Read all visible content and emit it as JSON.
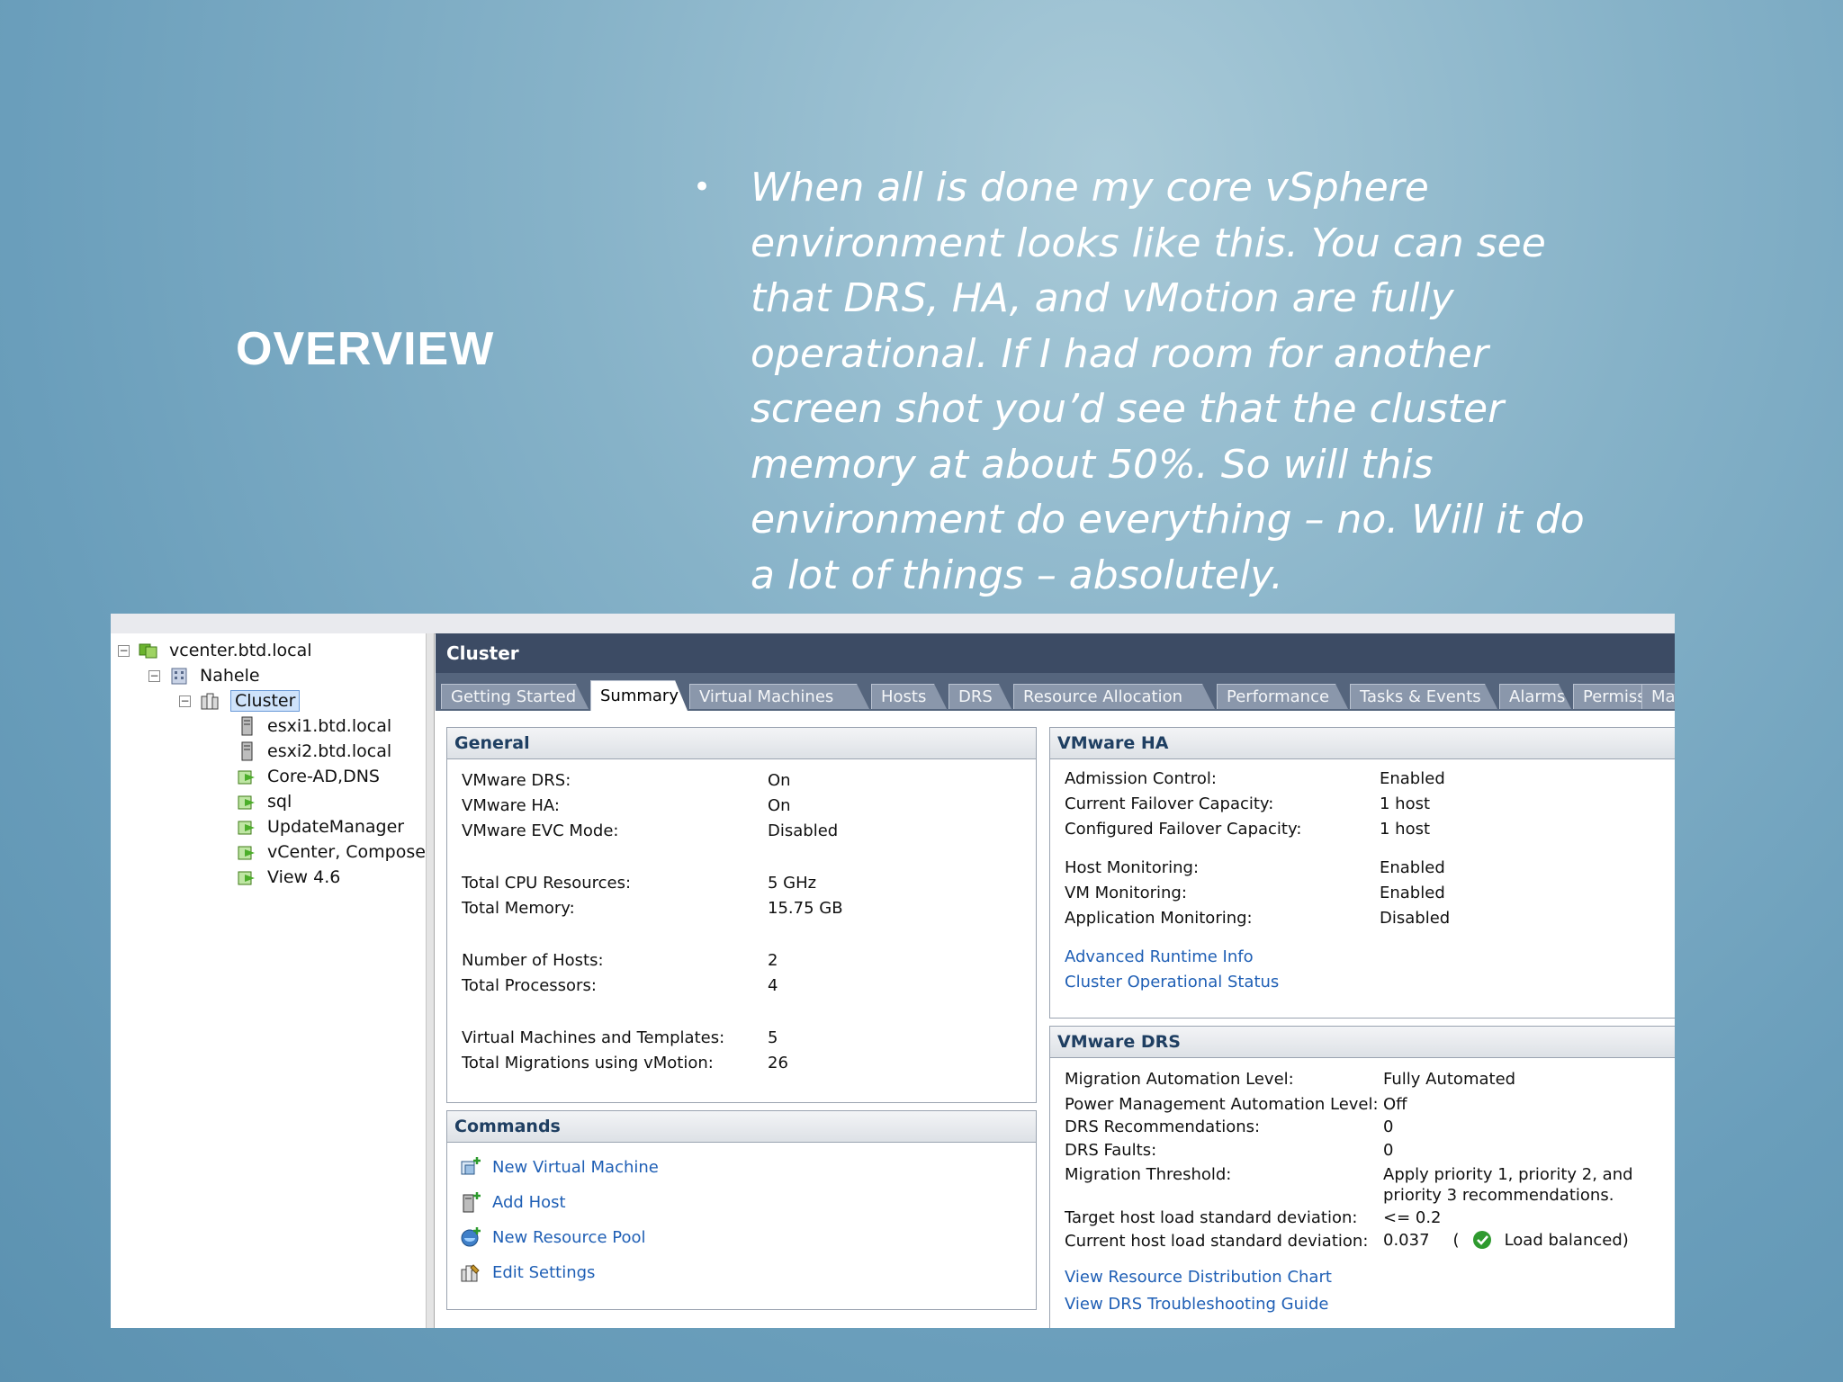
{
  "slide": {
    "title": "OVERVIEW",
    "bullet_symbol": "•",
    "bullet": "When all is done my core vSphere environment looks like this. You can see that DRS, HA, and vMotion are fully operational. If I had room for another screen shot you’d see that the cluster memory at about 50%. So will this environment do everything – no. Will it do a lot of things – absolutely."
  },
  "tree": {
    "items": [
      {
        "label": "vcenter.btd.local",
        "icon": "vcenter-icon"
      },
      {
        "label": "Nahele",
        "icon": "datacenter-icon"
      },
      {
        "label": "Cluster",
        "icon": "cluster-icon"
      },
      {
        "label": "esxi1.btd.local",
        "icon": "host-icon"
      },
      {
        "label": "esxi2.btd.local",
        "icon": "host-icon"
      },
      {
        "label": "Core-AD,DNS",
        "icon": "vm-icon"
      },
      {
        "label": "sql",
        "icon": "vm-icon"
      },
      {
        "label": "UpdateManager",
        "icon": "vm-icon"
      },
      {
        "label": "vCenter, Composer",
        "icon": "vm-icon"
      },
      {
        "label": "View 4.6",
        "icon": "vm-icon"
      }
    ]
  },
  "main": {
    "title": "Cluster",
    "tabs": [
      "Getting Started",
      "Summary",
      "Virtual Machines",
      "Hosts",
      "DRS",
      "Resource Allocation",
      "Performance",
      "Tasks & Events",
      "Alarms",
      "Permissions",
      "Maps"
    ],
    "active_tab": "Summary"
  },
  "general": {
    "title": "General",
    "rows": [
      {
        "label": "VMware DRS:",
        "value": "On"
      },
      {
        "label": "VMware HA:",
        "value": "On"
      },
      {
        "label": "VMware EVC Mode:",
        "value": "Disabled"
      },
      {
        "label": "Total CPU Resources:",
        "value": "5 GHz"
      },
      {
        "label": "Total Memory:",
        "value": "15.75 GB"
      },
      {
        "label": "Number of Hosts:",
        "value": "2"
      },
      {
        "label": "Total Processors:",
        "value": "4"
      },
      {
        "label": "Virtual Machines and Templates:",
        "value": "5"
      },
      {
        "label": "Total Migrations using vMotion:",
        "value": "26"
      }
    ]
  },
  "commands": {
    "title": "Commands",
    "items": [
      {
        "label": "New Virtual Machine",
        "icon": "new-vm-icon"
      },
      {
        "label": "Add Host",
        "icon": "add-host-icon"
      },
      {
        "label": "New Resource Pool",
        "icon": "resource-pool-icon"
      },
      {
        "label": "Edit Settings",
        "icon": "edit-settings-icon"
      }
    ]
  },
  "ha": {
    "title": "VMware HA",
    "rows": [
      {
        "label": "Admission Control:",
        "value": "Enabled"
      },
      {
        "label": "Current Failover Capacity:",
        "value": "1 host"
      },
      {
        "label": "Configured Failover Capacity:",
        "value": "1 host"
      },
      {
        "label": "Host Monitoring:",
        "value": "Enabled"
      },
      {
        "label": "VM Monitoring:",
        "value": "Enabled"
      },
      {
        "label": "Application Monitoring:",
        "value": "Disabled"
      }
    ],
    "links": [
      "Advanced Runtime Info",
      "Cluster Operational Status"
    ]
  },
  "drs": {
    "title": "VMware DRS",
    "rows": [
      {
        "label": "Migration Automation Level:",
        "value": "Fully Automated"
      },
      {
        "label": "Power Management Automation Level:",
        "value": "Off"
      },
      {
        "label": "DRS Recommendations:",
        "value": "0"
      },
      {
        "label": "DRS Faults:",
        "value": "0"
      },
      {
        "label": "Migration Threshold:",
        "value": "Apply priority 1, priority 2, and",
        "value2": "priority 3 recommendations."
      },
      {
        "label": "Target host load standard deviation:",
        "value": "<= 0.2"
      },
      {
        "label": "Current host load standard deviation:",
        "value": "0.037",
        "status_open": "(",
        "status": "Load balanced)"
      }
    ],
    "links": [
      "View Resource Distribution Chart",
      "View DRS Troubleshooting Guide"
    ]
  },
  "colors": {
    "link": "#1f5fb5",
    "header": "#3c4b64",
    "ok": "#2f9a2f"
  }
}
